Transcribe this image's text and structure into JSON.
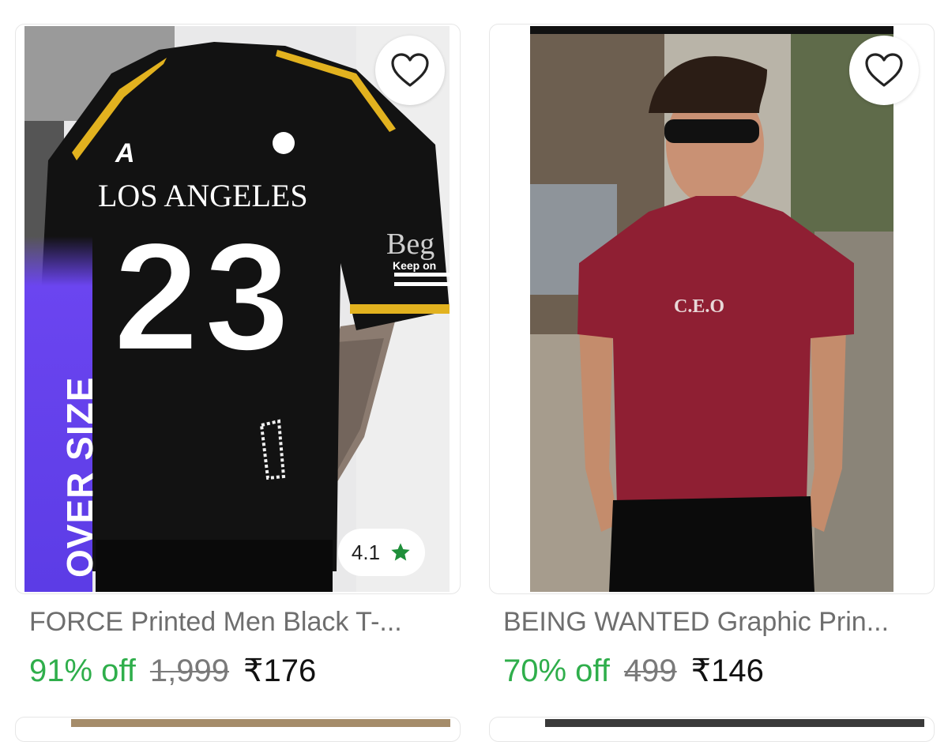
{
  "products": [
    {
      "title": "FORCE Printed Men Black T-...",
      "discount": "91% off",
      "mrp": "1,999",
      "price": "₹176",
      "badge": "OVER SIZE",
      "rating": "4.1",
      "print_text": {
        "city": "LOS ANGELES",
        "number": "23",
        "sleeve": "Beg",
        "sleeve_small": "Keep on"
      }
    },
    {
      "title": "BEING WANTED Graphic Prin...",
      "discount": "70% off",
      "mrp": "499",
      "price": "₹146",
      "print_text": {
        "logo": "C.E.O"
      }
    }
  ],
  "icons": {
    "wishlist": "heart-outline-icon",
    "rating": "star-icon"
  },
  "colors": {
    "discount": "#2fae4b",
    "rating_star": "#1f8f3a",
    "badge": "#5c3ce6"
  }
}
